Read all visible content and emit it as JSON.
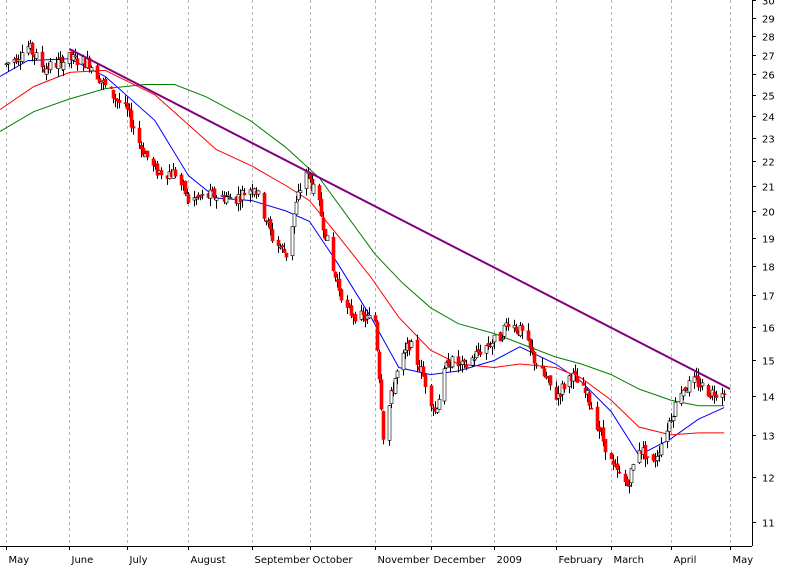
{
  "chart_data": {
    "type": "candlestick",
    "scale": "log",
    "grid": true,
    "ylim": [
      10.5,
      30
    ],
    "y_ticks": [
      11,
      12,
      13,
      14,
      15,
      16,
      17,
      18,
      19,
      20,
      21,
      22,
      23,
      24,
      25,
      26,
      27,
      28,
      29,
      30
    ],
    "x_ticks": [
      {
        "label": "May",
        "date": "2008-05-01"
      },
      {
        "label": "June",
        "date": "2008-06-02"
      },
      {
        "label": "July",
        "date": "2008-07-01"
      },
      {
        "label": "August",
        "date": "2008-08-01"
      },
      {
        "label": "September",
        "date": "2008-09-02"
      },
      {
        "label": "October",
        "date": "2008-10-01"
      },
      {
        "label": "November",
        "date": "2008-11-03"
      },
      {
        "label": "December",
        "date": "2008-12-01"
      },
      {
        "label": "2009",
        "date": "2009-01-02"
      },
      {
        "label": "February",
        "date": "2009-02-02"
      },
      {
        "label": "March",
        "date": "2009-03-02"
      },
      {
        "label": "April",
        "date": "2009-04-01"
      },
      {
        "label": "May",
        "date": "2009-05-01"
      }
    ],
    "date_range": [
      "2008-04-28",
      "2009-05-12"
    ],
    "price_anchors": [
      [
        "2008-05-01",
        26.5
      ],
      [
        "2008-05-12",
        27.4
      ],
      [
        "2008-05-20",
        26.3
      ],
      [
        "2008-06-02",
        26.8
      ],
      [
        "2008-06-12",
        26.6
      ],
      [
        "2008-06-20",
        25.4
      ],
      [
        "2008-07-01",
        24.2
      ],
      [
        "2008-07-08",
        22.6
      ],
      [
        "2008-07-15",
        21.6
      ],
      [
        "2008-07-25",
        21.5
      ],
      [
        "2008-08-01",
        20.4
      ],
      [
        "2008-08-12",
        20.6
      ],
      [
        "2008-08-25",
        20.5
      ],
      [
        "2008-09-03",
        21.0
      ],
      [
        "2008-09-12",
        19.0
      ],
      [
        "2008-09-19",
        18.4
      ],
      [
        "2008-09-25",
        20.6
      ],
      [
        "2008-09-29",
        21.6
      ],
      [
        "2008-10-06",
        20.2
      ],
      [
        "2008-10-13",
        17.8
      ],
      [
        "2008-10-20",
        16.5
      ],
      [
        "2008-10-27",
        16.3
      ],
      [
        "2008-11-03",
        16.2
      ],
      [
        "2008-11-07",
        13.0
      ],
      [
        "2008-11-13",
        14.5
      ],
      [
        "2008-11-20",
        15.5
      ],
      [
        "2008-11-26",
        14.7
      ],
      [
        "2008-12-03",
        13.6
      ],
      [
        "2008-12-10",
        15.0
      ],
      [
        "2008-12-18",
        14.8
      ],
      [
        "2008-12-26",
        15.3
      ],
      [
        "2009-01-05",
        15.7
      ],
      [
        "2009-01-09",
        16.2
      ],
      [
        "2009-01-16",
        15.8
      ],
      [
        "2009-01-23",
        14.9
      ],
      [
        "2009-02-02",
        14.0
      ],
      [
        "2009-02-10",
        14.6
      ],
      [
        "2009-02-18",
        14.0
      ],
      [
        "2009-02-25",
        13.0
      ],
      [
        "2009-03-03",
        12.2
      ],
      [
        "2009-03-10",
        11.8
      ],
      [
        "2009-03-16",
        12.7
      ],
      [
        "2009-03-23",
        12.3
      ],
      [
        "2009-03-30",
        13.2
      ],
      [
        "2009-04-06",
        14.2
      ],
      [
        "2009-04-14",
        14.4
      ],
      [
        "2009-04-21",
        14.1
      ],
      [
        "2009-04-28",
        14.2
      ]
    ],
    "series": [
      {
        "type": "ma",
        "color": "#0000ff",
        "points": [
          [
            "2008-04-28",
            25.9
          ],
          [
            "2008-05-12",
            26.7
          ],
          [
            "2008-06-02",
            26.8
          ],
          [
            "2008-06-20",
            25.9
          ],
          [
            "2008-07-15",
            23.8
          ],
          [
            "2008-08-01",
            21.4
          ],
          [
            "2008-08-15",
            20.5
          ],
          [
            "2008-09-02",
            20.4
          ],
          [
            "2008-09-19",
            20.0
          ],
          [
            "2008-10-01",
            19.6
          ],
          [
            "2008-10-15",
            18.1
          ],
          [
            "2008-11-01",
            16.3
          ],
          [
            "2008-11-15",
            14.8
          ],
          [
            "2008-12-01",
            14.6
          ],
          [
            "2008-12-15",
            14.7
          ],
          [
            "2009-01-02",
            15.0
          ],
          [
            "2009-01-15",
            15.4
          ],
          [
            "2009-02-02",
            14.9
          ],
          [
            "2009-02-15",
            14.4
          ],
          [
            "2009-03-02",
            13.6
          ],
          [
            "2009-03-16",
            12.5
          ],
          [
            "2009-04-01",
            12.9
          ],
          [
            "2009-04-15",
            13.4
          ],
          [
            "2009-04-28",
            13.7
          ]
        ]
      },
      {
        "type": "ma",
        "color": "#ff0000",
        "points": [
          [
            "2008-04-28",
            24.3
          ],
          [
            "2008-05-15",
            25.4
          ],
          [
            "2008-06-02",
            26.1
          ],
          [
            "2008-06-20",
            26.2
          ],
          [
            "2008-07-15",
            25.0
          ],
          [
            "2008-08-01",
            23.6
          ],
          [
            "2008-08-15",
            22.5
          ],
          [
            "2008-09-02",
            21.8
          ],
          [
            "2008-09-19",
            21.0
          ],
          [
            "2008-10-01",
            20.4
          ],
          [
            "2008-10-15",
            19.1
          ],
          [
            "2008-11-01",
            17.6
          ],
          [
            "2008-11-15",
            16.3
          ],
          [
            "2008-12-01",
            15.3
          ],
          [
            "2008-12-15",
            14.9
          ],
          [
            "2009-01-02",
            14.8
          ],
          [
            "2009-01-15",
            14.9
          ],
          [
            "2009-02-02",
            14.8
          ],
          [
            "2009-02-15",
            14.5
          ],
          [
            "2009-03-02",
            13.9
          ],
          [
            "2009-03-16",
            13.2
          ],
          [
            "2009-04-01",
            13.0
          ],
          [
            "2009-04-15",
            13.05
          ],
          [
            "2009-04-28",
            13.05
          ]
        ]
      },
      {
        "type": "ma",
        "color": "#008000",
        "points": [
          [
            "2008-04-28",
            23.3
          ],
          [
            "2008-05-15",
            24.2
          ],
          [
            "2008-06-02",
            24.8
          ],
          [
            "2008-06-20",
            25.3
          ],
          [
            "2008-07-10",
            25.5
          ],
          [
            "2008-07-25",
            25.5
          ],
          [
            "2008-08-10",
            24.9
          ],
          [
            "2008-09-01",
            23.8
          ],
          [
            "2008-09-19",
            22.6
          ],
          [
            "2008-10-06",
            21.3
          ],
          [
            "2008-10-20",
            19.8
          ],
          [
            "2008-11-03",
            18.4
          ],
          [
            "2008-11-17",
            17.4
          ],
          [
            "2008-12-01",
            16.6
          ],
          [
            "2008-12-15",
            16.1
          ],
          [
            "2009-01-02",
            15.8
          ],
          [
            "2009-01-15",
            15.5
          ],
          [
            "2009-02-02",
            15.1
          ],
          [
            "2009-02-15",
            14.9
          ],
          [
            "2009-03-02",
            14.6
          ],
          [
            "2009-03-16",
            14.2
          ],
          [
            "2009-04-01",
            13.9
          ],
          [
            "2009-04-15",
            13.75
          ],
          [
            "2009-04-28",
            13.75
          ]
        ]
      },
      {
        "type": "trendline",
        "color": "#800080",
        "points": [
          [
            "2008-06-02",
            27.3
          ],
          [
            "2009-05-01",
            14.2
          ]
        ]
      }
    ]
  }
}
